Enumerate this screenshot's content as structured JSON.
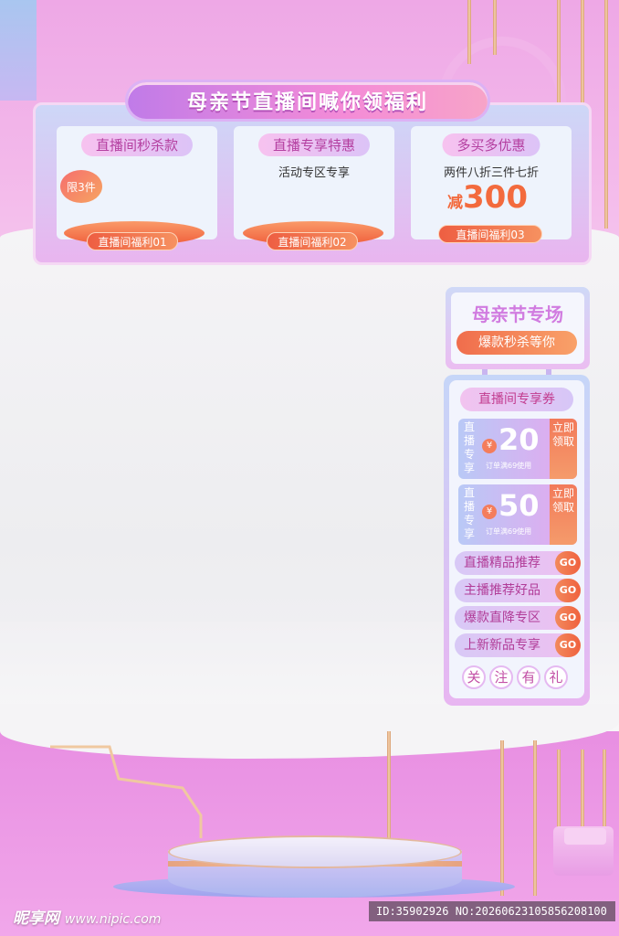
{
  "header": {
    "banner_title": "母亲节直播间喊你领福利"
  },
  "cards": [
    {
      "title": "直播间秒杀款",
      "subtitle": "",
      "tag": "限3件",
      "button": "直播间福利01"
    },
    {
      "title": "直播专享特惠",
      "subtitle": "活动专区专享",
      "button": "直播间福利02"
    },
    {
      "title": "多买多优惠",
      "subtitle": "两件八折三件七折",
      "prefix": "减",
      "amount": "300",
      "button": "直播间福利03"
    }
  ],
  "side_top": {
    "title": "母亲节专场",
    "subtitle": "爆款秒杀等你"
  },
  "coupons": {
    "title": "直播间专享券",
    "items": [
      {
        "left_label": "直播专享",
        "currency": "¥",
        "amount": "20",
        "condition": "订单满69使用",
        "claim": "立即领取"
      },
      {
        "left_label": "直播专享",
        "currency": "¥",
        "amount": "50",
        "condition": "订单满69使用",
        "claim": "立即领取"
      }
    ]
  },
  "nav": [
    {
      "label": "直播精品推荐",
      "go": "GO"
    },
    {
      "label": "主播推荐好品",
      "go": "GO"
    },
    {
      "label": "爆款直降专区",
      "go": "GO"
    },
    {
      "label": "上新新品专享",
      "go": "GO"
    }
  ],
  "follow": [
    "关",
    "注",
    "有",
    "礼"
  ],
  "watermark": {
    "logo": "昵享网",
    "url": "www.nipic.com",
    "id_text": "ID:35902926 NO:20260623105856208100"
  },
  "colors": {
    "accent_pink": "#e58be0",
    "accent_orange": "#f06d4c",
    "accent_purple": "#c07be8"
  }
}
